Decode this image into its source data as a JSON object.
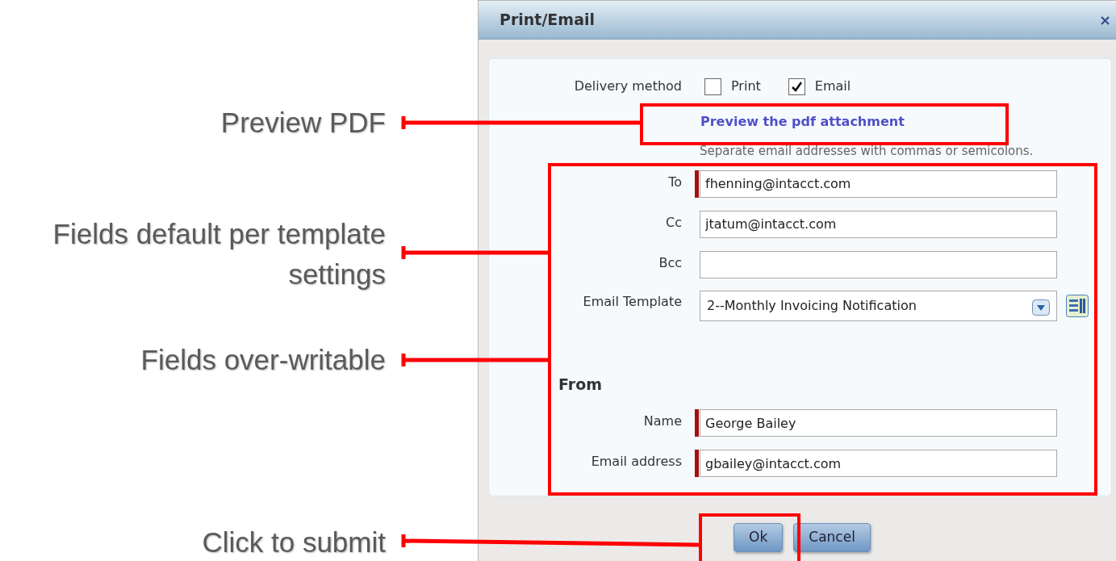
{
  "annotations": [
    {
      "text": "Preview PDF"
    },
    {
      "text": "Fields default per template settings"
    },
    {
      "text": "Fields over-writable"
    },
    {
      "text": "Click to submit"
    }
  ],
  "dialog": {
    "title": "Print/Email",
    "close": "×",
    "delivery": {
      "label": "Delivery method",
      "options": [
        {
          "label": "Print",
          "checked": false
        },
        {
          "label": "Email",
          "checked": true
        }
      ]
    },
    "preview_link": "Preview the pdf attachment",
    "hint": "Separate email addresses with commas or semicolons.",
    "fields": [
      {
        "label": "To",
        "value": "fhenning@intacct.com",
        "required": true
      },
      {
        "label": "Cc",
        "value": "jtatum@intacct.com",
        "required": false
      },
      {
        "label": "Bcc",
        "required": false
      }
    ],
    "template": {
      "label": "Email Template",
      "value": "2--Monthly Invoicing Notification"
    },
    "from_heading": "From",
    "from_fields": [
      {
        "label": "Name",
        "value": "George Bailey",
        "required": true
      },
      {
        "label": "Email address",
        "value": "gbailey@intacct.com",
        "required": true
      }
    ],
    "buttons": [
      "Ok",
      "Cancel"
    ]
  }
}
